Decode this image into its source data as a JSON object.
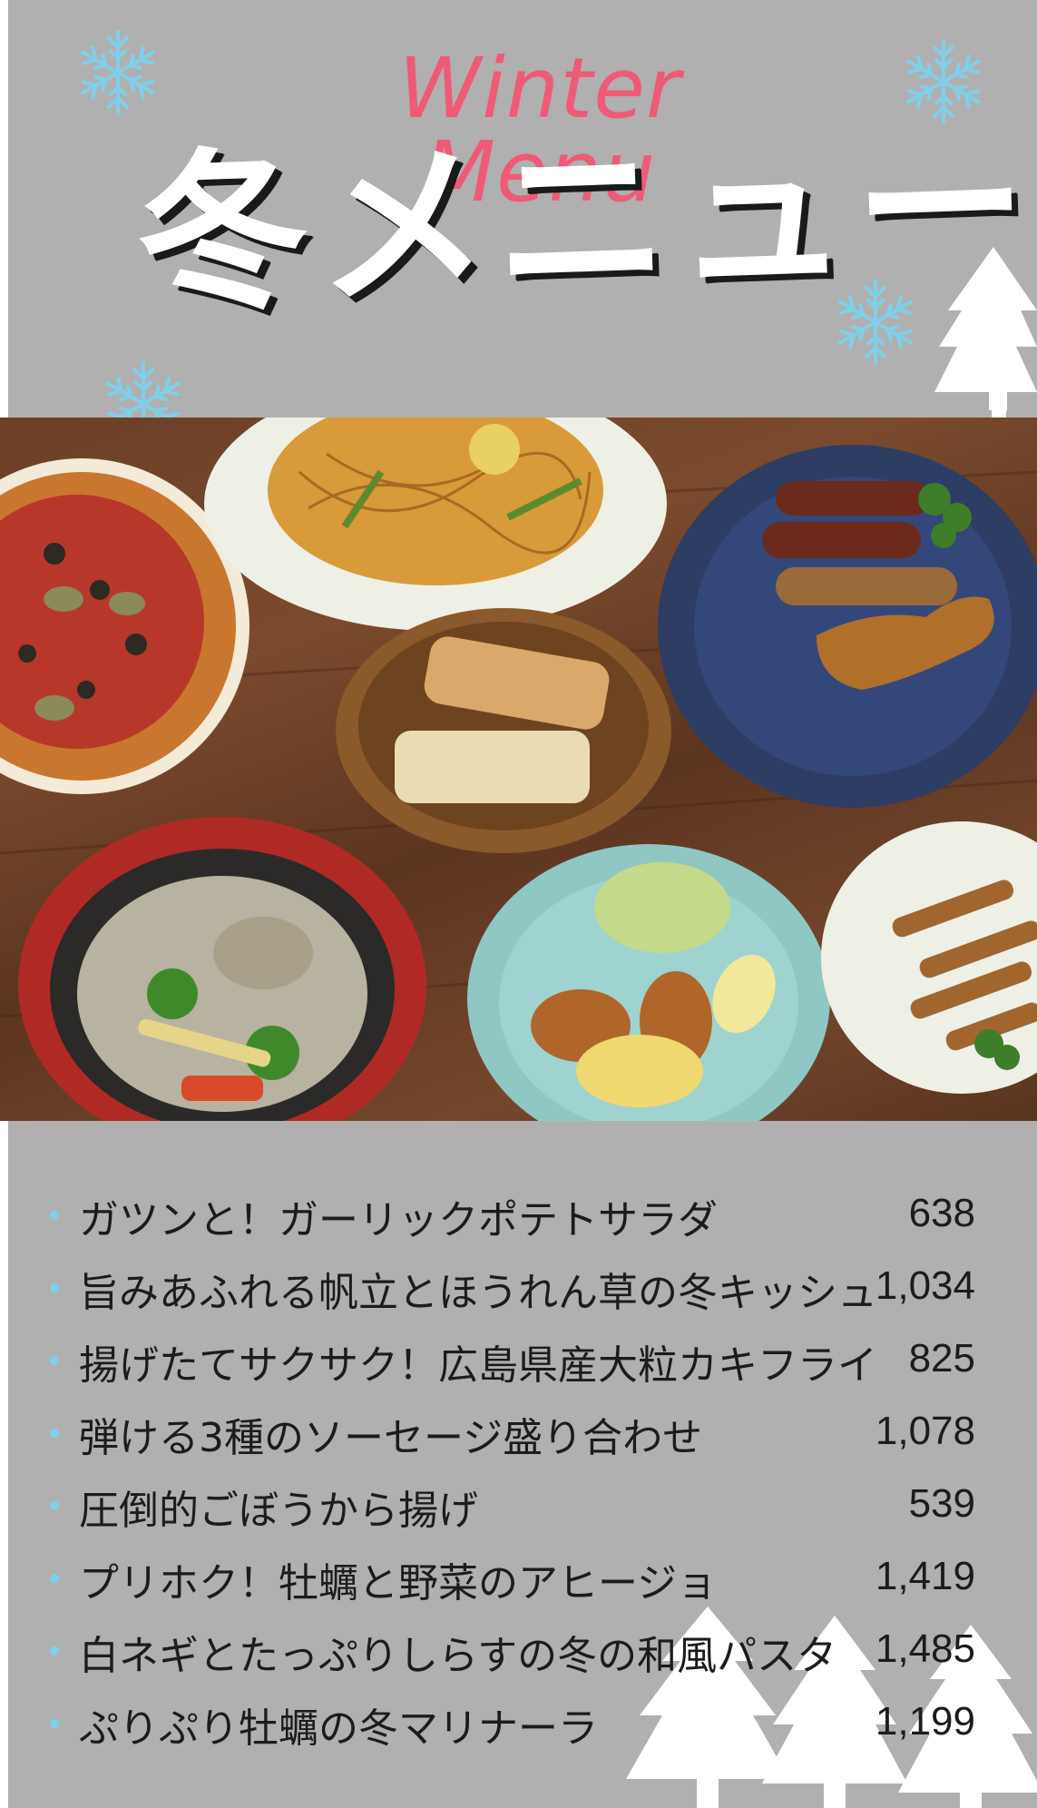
{
  "header": {
    "subtitle": "Winter Menu",
    "title": "冬メニュー"
  },
  "colors": {
    "background": "#b0b0b0",
    "subtitle": "#ef5a76",
    "title": "#ffffff",
    "snowflake": "#7ed0ea",
    "bullet": "#7ed0ea",
    "text": "#1c1c1c"
  },
  "photo": {
    "description_icon": "food-photo"
  },
  "menu": {
    "items": [
      {
        "name": "ガツンと！ガーリックポテトサラダ",
        "price": "638"
      },
      {
        "name": "旨みあふれる帆立とほうれん草の冬キッシュ",
        "price": "1,034"
      },
      {
        "name": "揚げたてサクサク！広島県産大粒カキフライ",
        "price": "825"
      },
      {
        "name": "弾ける3種のソーセージ盛り合わせ",
        "price": "1,078"
      },
      {
        "name": "圧倒的ごぼうから揚げ",
        "price": "539"
      },
      {
        "name": "プリホク！牡蠣と野菜のアヒージョ",
        "price": "1,419"
      },
      {
        "name": "白ネギとたっぷりしらすの冬の和風パスタ",
        "price": "1,485"
      },
      {
        "name": "ぷりぷり牡蠣の冬マリナーラ",
        "price": "1,199"
      }
    ]
  }
}
